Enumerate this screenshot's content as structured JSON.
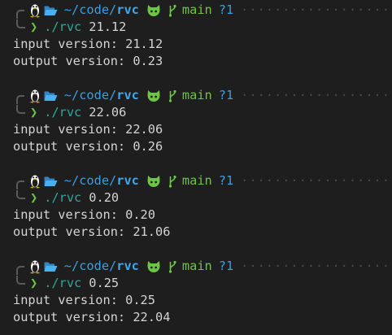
{
  "prompt": {
    "path_prefix": "~/code/",
    "path_dir": "rvc",
    "branch": "main",
    "status": "?1",
    "trail": "·····················"
  },
  "sessions": [
    {
      "command": "./rvc",
      "arg": "21.12",
      "output": [
        "input version: 21.12",
        "output version: 0.23"
      ]
    },
    {
      "command": "./rvc",
      "arg": "22.06",
      "output": [
        "input version: 22.06",
        "output version: 0.26"
      ]
    },
    {
      "command": "./rvc",
      "arg": "0.20",
      "output": [
        "input version: 0.20",
        "output version: 21.06"
      ]
    },
    {
      "command": "./rvc",
      "arg": "0.25",
      "output": [
        "input version: 0.25",
        "output version: 22.04"
      ]
    }
  ],
  "icons": {
    "os": "linux-tux-icon",
    "folder": "folder-open-icon",
    "repo": "github-octocat-icon",
    "branch": "git-branch-icon"
  },
  "colors": {
    "background": "#1e1e1e",
    "path": "#3b9ee0",
    "branch": "#6cc644",
    "command": "#2fa89a"
  }
}
